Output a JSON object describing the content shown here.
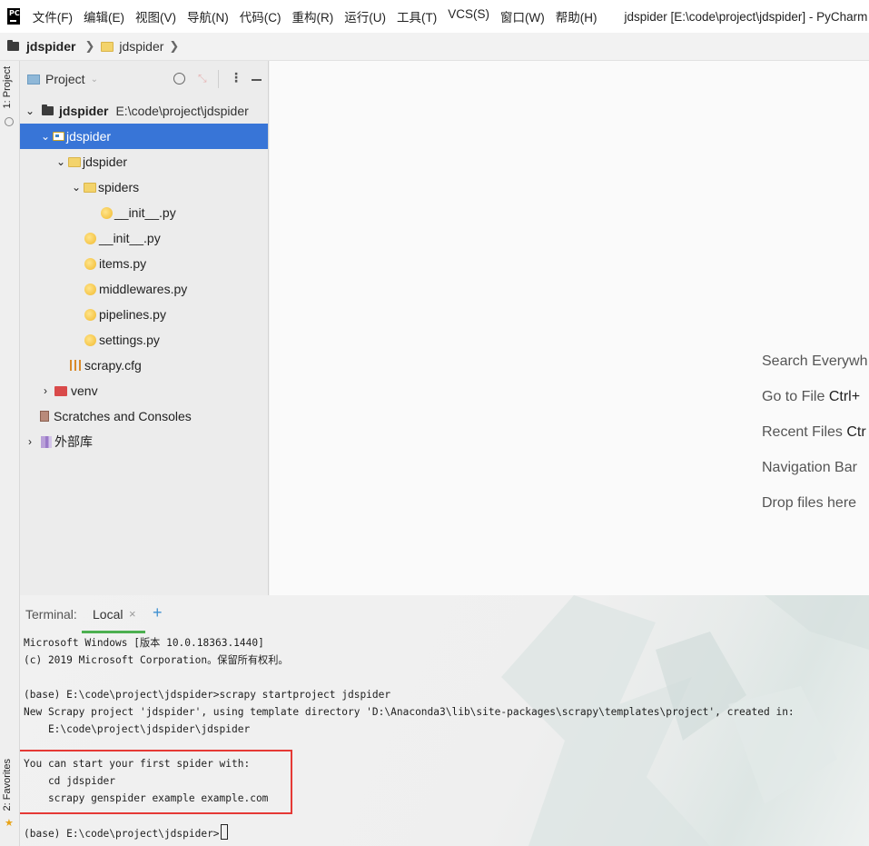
{
  "menubar": {
    "logo_text": "PC",
    "items": [
      "文件(F)",
      "编辑(E)",
      "视图(V)",
      "导航(N)",
      "代码(C)",
      "重构(R)",
      "运行(U)",
      "工具(T)",
      "VCS(S)",
      "窗口(W)",
      "帮助(H)"
    ],
    "window_title": "jdspider [E:\\code\\project\\jdspider] - PyCharm (A"
  },
  "navbar": {
    "crumbs": [
      "jdspider",
      "jdspider"
    ]
  },
  "left_stripe": {
    "project_tab": "1: Project",
    "favorites_tab": "2: Favorites"
  },
  "project_panel": {
    "title": "Project",
    "tree": [
      {
        "label": "jdspider",
        "extra": "E:\\code\\project\\jdspider",
        "depth": 0,
        "arrow": "down",
        "icon": "folder-dark-icon"
      },
      {
        "label": "jdspider",
        "depth": 1,
        "arrow": "down",
        "icon": "module-folder-icon",
        "selected": true
      },
      {
        "label": "jdspider",
        "depth": 2,
        "arrow": "down",
        "icon": "folder-icon"
      },
      {
        "label": "spiders",
        "depth": 3,
        "arrow": "down",
        "icon": "folder-icon"
      },
      {
        "label": "__init__.py",
        "depth": 5,
        "icon": "python-file-icon"
      },
      {
        "label": "__init__.py",
        "depth": 4,
        "icon": "python-file-icon"
      },
      {
        "label": "items.py",
        "depth": 4,
        "icon": "python-file-icon"
      },
      {
        "label": "middlewares.py",
        "depth": 4,
        "icon": "python-file-icon"
      },
      {
        "label": "pipelines.py",
        "depth": 4,
        "icon": "python-file-icon"
      },
      {
        "label": "settings.py",
        "depth": 4,
        "icon": "python-file-icon"
      },
      {
        "label": "scrapy.cfg",
        "depth": 3,
        "icon": "config-file-icon"
      },
      {
        "label": "venv",
        "depth": 1,
        "arrow": "right",
        "icon": "venv-folder-icon"
      },
      {
        "label": "Scratches and Consoles",
        "depth": 1,
        "icon": "scratches-icon"
      },
      {
        "label": "外部库",
        "depth": 0,
        "arrow": "right",
        "icon": "external-libraries-icon"
      }
    ]
  },
  "editor": {
    "hints": [
      {
        "text": "Search Everywh",
        "key": ""
      },
      {
        "text": "Go to File ",
        "key": "Ctrl+"
      },
      {
        "text": "Recent Files ",
        "key": "Ctr"
      },
      {
        "text": "Navigation Bar",
        "key": ""
      },
      {
        "text": "Drop files here ",
        "key": ""
      }
    ]
  },
  "terminal": {
    "label": "Terminal:",
    "tab": "Local",
    "lines": [
      "Microsoft Windows [版本 10.0.18363.1440]",
      "(c) 2019 Microsoft Corporation。保留所有权利。",
      "",
      "(base) E:\\code\\project\\jdspider>scrapy startproject jdspider",
      "New Scrapy project 'jdspider', using template directory 'D:\\Anaconda3\\lib\\site-packages\\scrapy\\templates\\project', created in:",
      "    E:\\code\\project\\jdspider\\jdspider",
      "",
      "You can start your first spider with:",
      "    cd jdspider",
      "    scrapy genspider example example.com",
      "",
      "(base) E:\\code\\project\\jdspider>"
    ]
  },
  "colors": {
    "selection": "#3875d7",
    "highlight_box": "#e53935",
    "terminal_tab_underline": "#4caf50"
  }
}
